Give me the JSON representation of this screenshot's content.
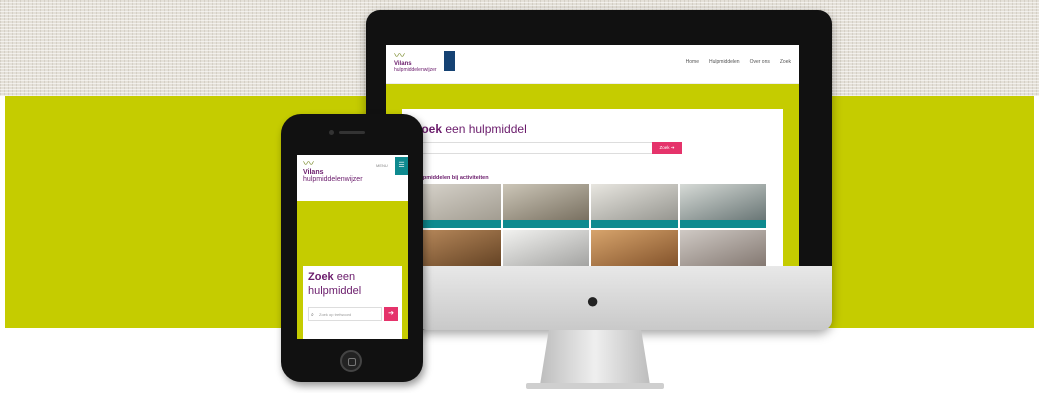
{
  "colors": {
    "accent_green": "#c5cc00",
    "brand_purple": "#6a1b6b",
    "cta_pink": "#e5336b",
    "teal": "#0e8a8f"
  },
  "desktop": {
    "logo_brand": "Vilans",
    "logo_sub": "hulpmiddelenwijzer",
    "nav": [
      "Home",
      "Hulpmiddelen",
      "Over ons",
      "Zoek"
    ],
    "title_bold": "Zoek",
    "title_rest": " een hulpmiddel",
    "search_button": "Zoek",
    "section_title": "Hulpmiddelen bij activiteiten",
    "tiles": [
      {
        "image": "wheelchair-photo"
      },
      {
        "image": "tableware-photo"
      },
      {
        "image": "bath-photo"
      },
      {
        "image": "kitchen-photo"
      },
      {
        "image": "chair-photo"
      },
      {
        "image": "glasses-photo"
      },
      {
        "image": "stairs-photo"
      },
      {
        "image": "walker-photo"
      }
    ]
  },
  "mobile": {
    "logo_brand": "Vilans",
    "logo_sub": "hulpmiddelenwijzer",
    "menu_label": "MENU",
    "burger_icon": "hamburger-icon",
    "title_bold": "Zoek",
    "title_rest": " een hulpmiddel",
    "search_placeholder": "Zoek op trefwoord",
    "go_icon": "arrow-right-icon"
  }
}
